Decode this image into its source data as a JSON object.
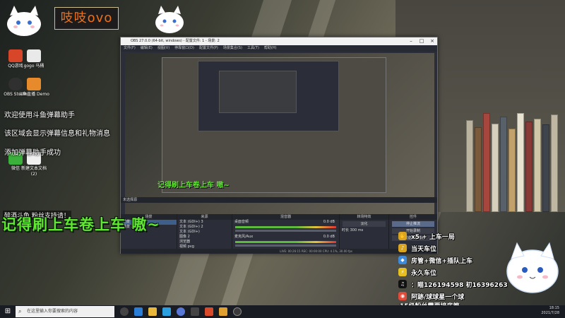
{
  "streamer_name": "吱吱ovo",
  "desktop_icons": [
    {
      "label": "QQ游戏"
    },
    {
      "label": "gogo 马桶"
    },
    {
      "label": "OBS Studio"
    },
    {
      "label": "斗鱼直播 Demo"
    },
    {
      "label": "微信"
    },
    {
      "label": "新建文本文档 (2)"
    }
  ],
  "notices": [
    "欢迎使用斗鱼弹幕助手",
    "该区域会显示弹幕信息和礼物消息",
    "添加弹幕助手成功"
  ],
  "danmu_warning": "醉酒斗鱼,粉丝支持请！",
  "subtitle": "记得刷上车卷上车 嗷~",
  "obs": {
    "title": "OBS 27.0.0 (64-bit, windows) - 配置文件: 1 - 场景: 2",
    "menu": [
      "文件(F)",
      "编辑(E)",
      "视图(V)",
      "停靠窗口(D)",
      "配置文件(P)",
      "场景集合(S)",
      "工具(T)",
      "帮助(H)"
    ],
    "status_label": "未选择源",
    "docks": {
      "scenes": {
        "title": "场景",
        "items": [
          "场景",
          "场景 2"
        ]
      },
      "sources": {
        "title": "来源",
        "items": [
          "文本 (GDI+) 3",
          "文本 (GDI+) 2",
          "文本 (GDI+)",
          "图像 2",
          "浏览器",
          "视频 pvg"
        ]
      },
      "mixer": {
        "title": "混音器",
        "channels": [
          {
            "name": "桌面音频",
            "db": "0.0 dB"
          },
          {
            "name": "麦克风/Aux",
            "db": "0.0 dB"
          }
        ]
      },
      "transitions": {
        "title": "转场特效",
        "type": "淡化",
        "duration_label": "时长",
        "duration": "300 ms"
      },
      "controls": {
        "title": "控件",
        "buttons": [
          "停止推流",
          "开始录制",
          "启动虚拟摄像机",
          "工作室模式",
          "设置",
          "退出"
        ]
      }
    },
    "statusbar": "LIVE: 00:26:15  REC: 00:00:00  CPU: 4.1%, 30.00 fps"
  },
  "info_lines": [
    {
      "icon": "hand-icon",
      "text": "x5 + 上车一局",
      "color": "#d9a520"
    },
    {
      "icon": "speaker-icon",
      "text": "当天车位",
      "color": "#d9a520"
    },
    {
      "icon": "water-icon",
      "text": "房管+微信+插队上车",
      "color": "#3c8ad9"
    },
    {
      "icon": "lightning-icon",
      "text": "永久车位",
      "color": "#e6c020"
    },
    {
      "icon": "tiktok-icon",
      "text": "：瞄126194598 初16396263",
      "color": "#111111"
    },
    {
      "icon": "weibo-icon",
      "text": "阿跡/球球星一个球",
      "color": "#e24a3a"
    }
  ],
  "fans_line": "15级粉丝需要接房管",
  "taskbar": {
    "search_placeholder": "在这里输入你要搜索的内容",
    "time": "18:15",
    "date": "2021/7/28"
  },
  "colors": {
    "subtitle": "#5fe830",
    "streamer_name": "#f07018"
  }
}
